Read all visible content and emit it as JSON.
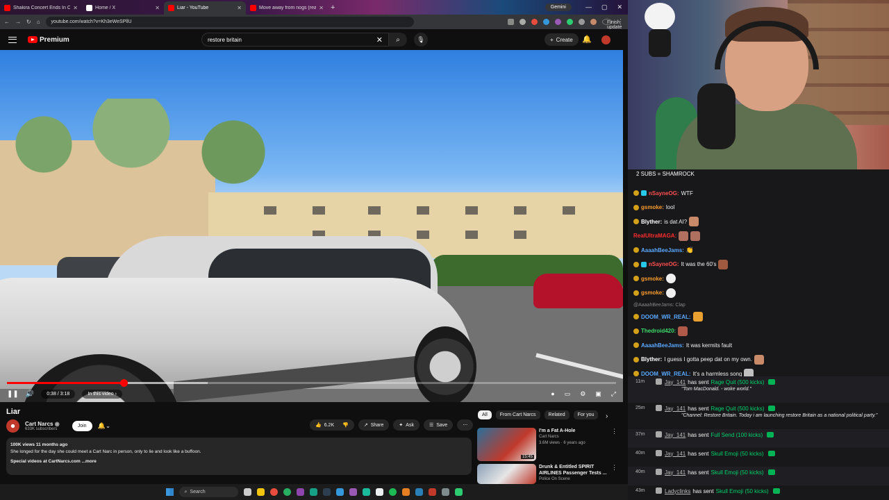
{
  "browser": {
    "tabs": [
      {
        "title": "Shakira Concert Ends In Comp",
        "color": "#ff0000",
        "active": false
      },
      {
        "title": "Home / X",
        "color": "#ffffff",
        "active": false
      },
      {
        "title": "Liar - YouTube",
        "color": "#ff0000",
        "active": true
      },
      {
        "title": "Move away from nogs (read d",
        "color": "#ff0000",
        "active": false
      }
    ],
    "gemini_label": "Gemini",
    "url": "youtube.com/watch?v=Kh3eWeSPllU",
    "finish_update_label": "Finish update"
  },
  "youtube": {
    "logo_text": "Premium",
    "search_query": "restore britain",
    "create_label": "Create",
    "video": {
      "time": "0:38 / 3:18",
      "in_this_video": "In this video",
      "progress": 0.192,
      "buffered": 0.33
    },
    "title": "Liar",
    "channel": {
      "name": "Cart Narcs",
      "subscribers": "633K subscribers",
      "join_label": "Join"
    },
    "actions": {
      "likes": "6.2K",
      "share": "Share",
      "ask": "Ask",
      "save": "Save"
    },
    "description": {
      "meta": "100K views  11 months ago",
      "text": "She longed for the day she could meet a Cart Narc in person, only to lie and look like a buffoon.",
      "link_line": "Special videos at CartNarcs.com ...more"
    },
    "chips": [
      "All",
      "From Cart Narcs",
      "Related",
      "For you"
    ],
    "recommendations": [
      {
        "title": "I'm a Fat A-Hole",
        "channel": "Cart Narcs",
        "stats": "3.6M views · 6 years ago",
        "duration": "15:45",
        "thumb_color": "#c0392b"
      },
      {
        "title": "Drunk & Entitled SPIRIT AIRLINES Passenger Tests ...",
        "channel": "Police On Scene",
        "stats": "",
        "duration": "",
        "thumb_color": "#5a6f8a"
      }
    ]
  },
  "taskbar": {
    "search_label": "Search"
  },
  "stream": {
    "sub_goal": "2 SUBS = SHAMROCK",
    "chat": [
      {
        "user": "nSayneOG:",
        "text": "WTF",
        "color": "#ff4f4f",
        "emote": ""
      },
      {
        "user": "gsmoke:",
        "text": "lool",
        "color": "#ff9d2b",
        "emote": ""
      },
      {
        "user": "Blyther:",
        "text": "is dat AI?",
        "color": "#ffffff",
        "emote": "#c98a6a"
      },
      {
        "user": "RealUltraMAGA:",
        "text": "",
        "color": "#ff2d2d",
        "emote": "#b07060"
      },
      {
        "user": "AaaahBeeJams:",
        "text": "",
        "color": "#5aa9ff",
        "emote": "#e0e0e0"
      },
      {
        "user": "nSayneOG:",
        "text": "It was the 60's",
        "color": "#ff4f4f",
        "emote": "#a05a40"
      },
      {
        "user": "gsmoke:",
        "text": "",
        "color": "#ff9d2b",
        "emote": "#f0f0f0"
      },
      {
        "user": "gsmoke:",
        "text": "",
        "color": "#ff9d2b",
        "emote": "#f0f0f0"
      }
    ],
    "reply_to": "@AaaahBeeJams: Clap",
    "chat2": [
      {
        "user": "DOOM_WR_REAL:",
        "text": "",
        "color": "#5aa9ff",
        "emote": "#e8a030"
      },
      {
        "user": "Thedroid420:",
        "text": "",
        "color": "#3ddc6a",
        "emote": "#b05a4a"
      },
      {
        "user": "AaaahBeeJams:",
        "text": "It was kermits fault",
        "color": "#5aa9ff",
        "emote": ""
      },
      {
        "user": "Blyther:",
        "text": "I guess I gotta peep dat on my own.",
        "color": "#ffffff",
        "emote": "#c98a6a"
      },
      {
        "user": "DOOM_WR_REAL:",
        "text": "It's a harmless song",
        "color": "#5aa9ff",
        "emote": "#c0c0c0"
      }
    ],
    "events": [
      {
        "time": "11m",
        "user": "Jay_141",
        "verb": "has sent",
        "gift": "Rage Quit (500 kicks)",
        "quote": "\"Tom MacDonald. - woke world.\""
      },
      {
        "time": "25m",
        "user": "Jay_141",
        "verb": "has sent",
        "gift": "Rage Quit (500 kicks)",
        "quote": "\"Channel: Restore Britain. Today i am launching restore Britain as a national political party.\""
      },
      {
        "time": "37m",
        "user": "Jay_141",
        "verb": "has sent",
        "gift": "Full Send (100 kicks)",
        "quote": ""
      },
      {
        "time": "40m",
        "user": "Jay_141",
        "verb": "has sent",
        "gift": "Skull Emoji (50 kicks)",
        "quote": ""
      },
      {
        "time": "40m",
        "user": "Jay_141",
        "verb": "has sent",
        "gift": "Skull Emoji (50 kicks)",
        "quote": ""
      },
      {
        "time": "43m",
        "user": "Ladyclinks",
        "verb": "has sent",
        "gift": "Skull Emoji (50 kicks)",
        "quote": ""
      }
    ]
  }
}
